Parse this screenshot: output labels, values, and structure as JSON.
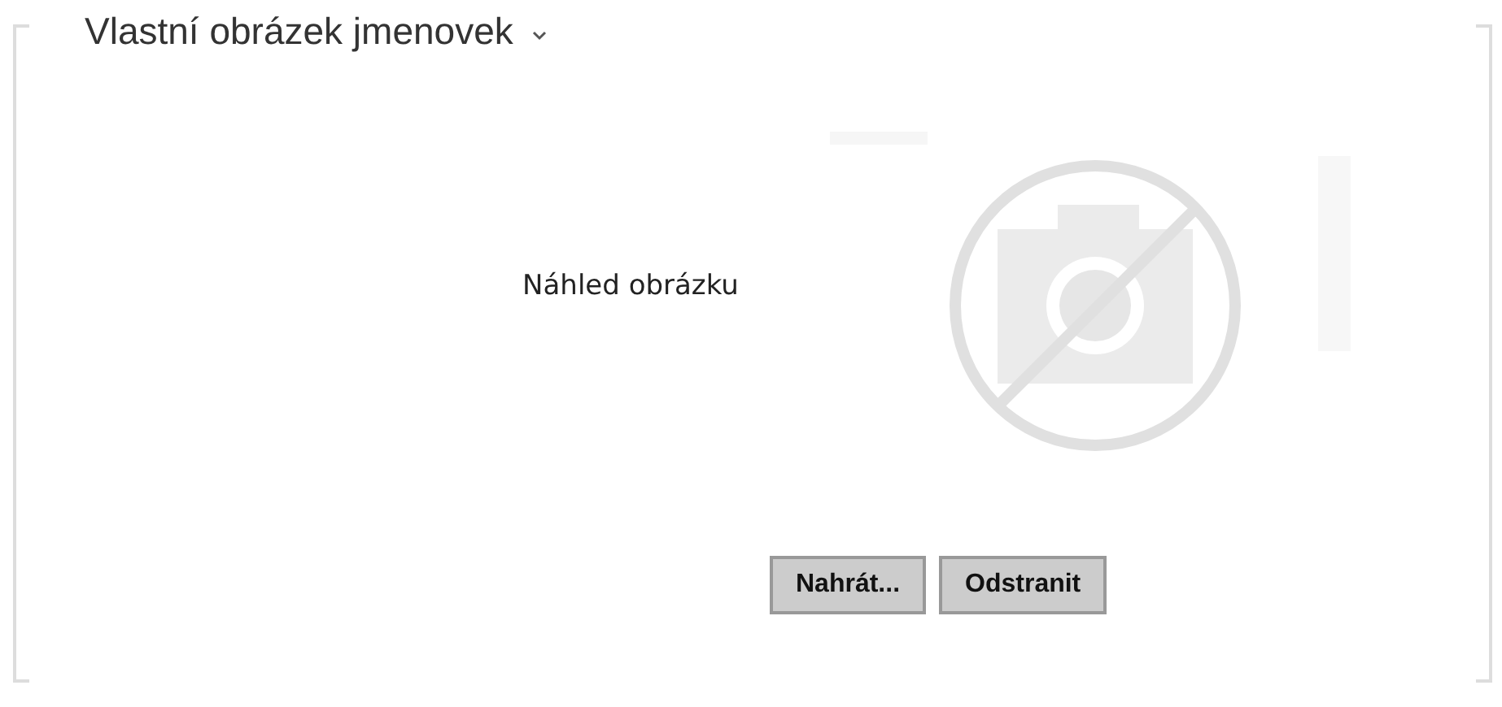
{
  "section": {
    "title": "Vlastní obrázek jmenovek",
    "expanded": true
  },
  "preview": {
    "label": "Náhled obrázku"
  },
  "buttons": [
    {
      "label": "Nahrát..."
    },
    {
      "label": "Odstranit"
    }
  ]
}
